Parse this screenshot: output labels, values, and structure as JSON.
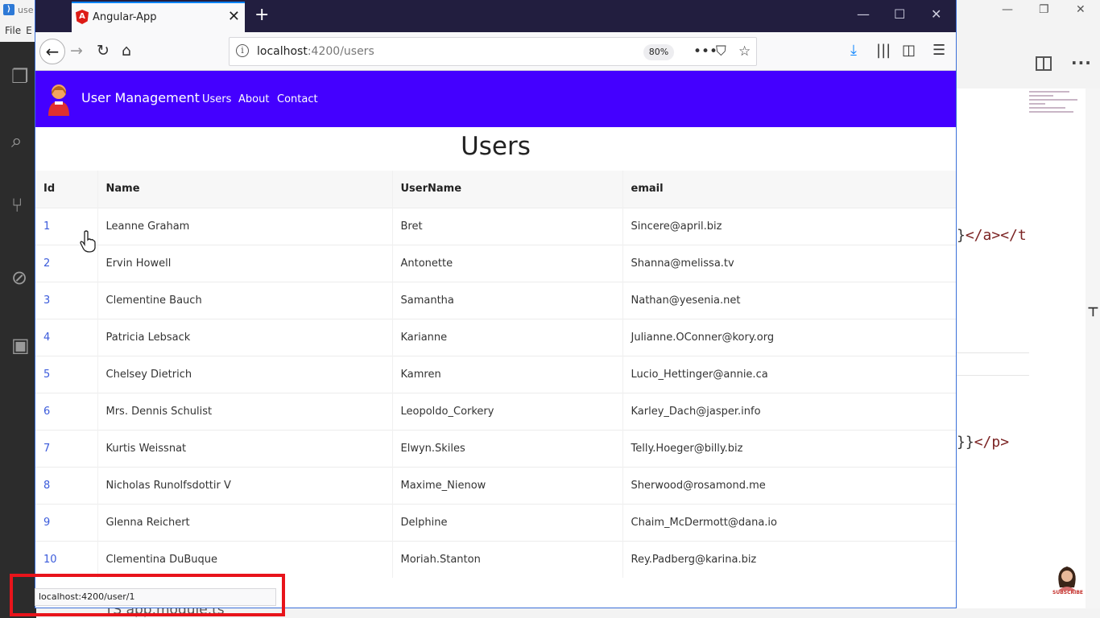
{
  "background_editor": {
    "title_fragment": "use",
    "menu": [
      "File",
      "E"
    ],
    "code_lines": [
      {
        "punc": "}",
        "tags": "</a></t"
      },
      {
        "punc": "}}",
        "tags": "</p>"
      }
    ],
    "bottom_file": "TS  app.module.ts"
  },
  "browser": {
    "tab_title": "Angular-App",
    "url_host": "localhost",
    "url_path": ":4200/users",
    "zoom": "80%",
    "status_tooltip": "localhost:4200/user/1"
  },
  "app": {
    "brand": "User Management",
    "nav": [
      "Users",
      "About",
      "Contact"
    ],
    "heading": "Users",
    "table": {
      "headers": [
        "Id",
        "Name",
        "UserName",
        "email"
      ],
      "rows": [
        [
          "1",
          "Leanne Graham",
          "Bret",
          "Sincere@april.biz"
        ],
        [
          "2",
          "Ervin Howell",
          "Antonette",
          "Shanna@melissa.tv"
        ],
        [
          "3",
          "Clementine Bauch",
          "Samantha",
          "Nathan@yesenia.net"
        ],
        [
          "4",
          "Patricia Lebsack",
          "Karianne",
          "Julianne.OConner@kory.org"
        ],
        [
          "5",
          "Chelsey Dietrich",
          "Kamren",
          "Lucio_Hettinger@annie.ca"
        ],
        [
          "6",
          "Mrs. Dennis Schulist",
          "Leopoldo_Corkery",
          "Karley_Dach@jasper.info"
        ],
        [
          "7",
          "Kurtis Weissnat",
          "Elwyn.Skiles",
          "Telly.Hoeger@billy.biz"
        ],
        [
          "8",
          "Nicholas Runolfsdottir V",
          "Maxime_Nienow",
          "Sherwood@rosamond.me"
        ],
        [
          "9",
          "Glenna Reichert",
          "Delphine",
          "Chaim_McDermott@dana.io"
        ],
        [
          "10",
          "Clementina DuBuque",
          "Moriah.Stanton",
          "Rey.Padberg@karina.biz"
        ]
      ]
    }
  },
  "overlay": {
    "subscribe_label": "SUBSCRIBE"
  },
  "colors": {
    "app_navbar": "#4400ff",
    "firefox_titlebar": "#221e3f",
    "highlight_box": "#e8141b",
    "id_link": "#3b5bdb"
  }
}
